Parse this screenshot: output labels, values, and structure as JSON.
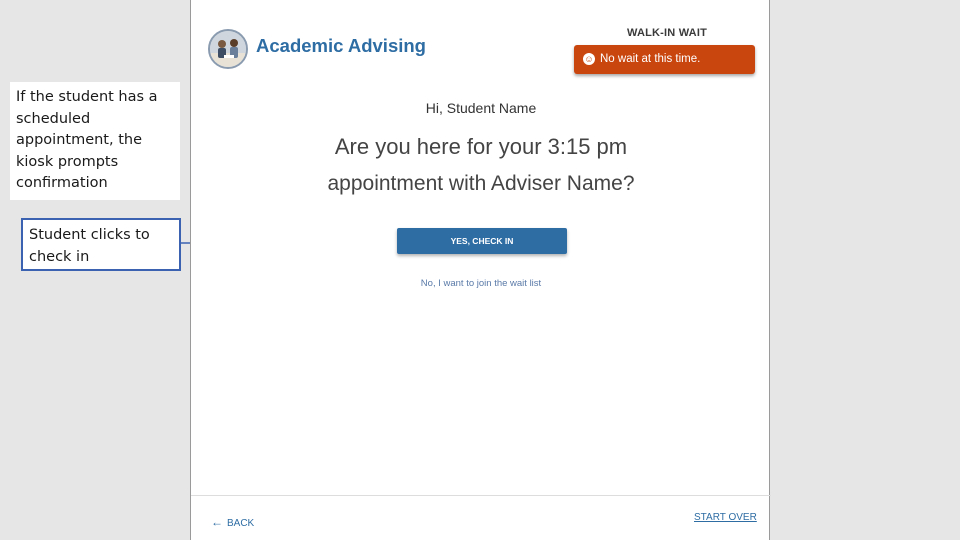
{
  "annotations": {
    "note1": "If the student has a scheduled appointment, the kiosk prompts confirmation",
    "note2": "Student clicks to check in"
  },
  "kiosk": {
    "brand": "Academic Advising",
    "walk_in_title": "WALK-IN WAIT",
    "wait_status": "No wait at this time.",
    "greeting": "Hi, Student Name",
    "question_line1": "Are you here for your 3:15 pm",
    "question_line2": "appointment with Adviser Name?",
    "checkin_button": "YES, CHECK IN",
    "waitlist_link": "No, I want to join the wait list",
    "back_label": "BACK",
    "start_over_label": "START OVER"
  },
  "colors": {
    "accent": "#2e6da4",
    "wait_badge": "#c9460f",
    "annotation_border": "#3a62b0"
  },
  "icons": {
    "logo": "advisors-photo-logo",
    "wait_status": "smiley-icon",
    "back": "back-arrow-icon"
  }
}
